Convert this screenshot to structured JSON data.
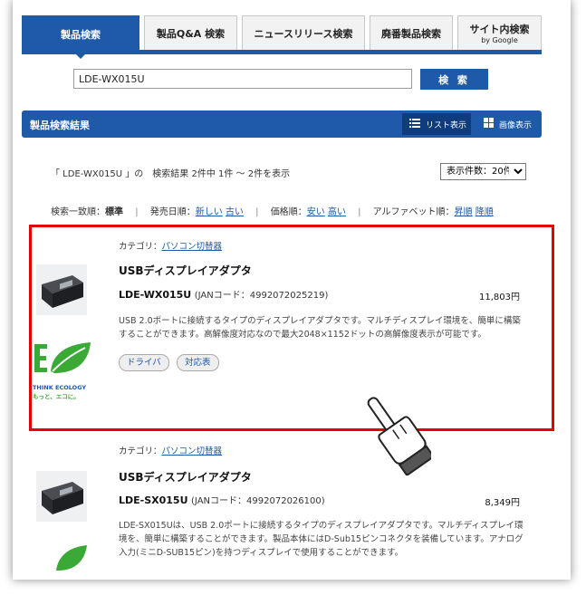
{
  "tabs": [
    {
      "label": "製品検索",
      "sub": ""
    },
    {
      "label": "製品Q&A 検索",
      "sub": ""
    },
    {
      "label": "ニュースリリース検索",
      "sub": ""
    },
    {
      "label": "廃番製品検索",
      "sub": ""
    },
    {
      "label": "サイト内検索",
      "sub": "by Google"
    }
  ],
  "search": {
    "value": "LDE-WX015U",
    "button": "検 索"
  },
  "results": {
    "title": "製品検索結果",
    "view_list": "リスト表示",
    "view_image": "画像表示",
    "summary": "「 LDE-WX015U 」の　検索結果 2件中 1件 ～ 2件を表示",
    "per_page": "表示件数：20件"
  },
  "sort": {
    "relevance_label": "検索一致順：",
    "relevance_value": "標準",
    "date_label": "発売日順：",
    "date_new": "新しい",
    "date_old": "古い",
    "price_label": "価格順：",
    "price_low": "安い",
    "price_high": "高い",
    "alpha_label": "アルファベット順：",
    "alpha_asc": "昇順",
    "alpha_desc": "降順"
  },
  "products": [
    {
      "category_label": "カテゴリ：",
      "category": "パソコン切替器",
      "name": "USBディスプレイアダプタ",
      "model": "LDE-WX015U",
      "jan": "(JANコード：4992072025219)",
      "price": "11,803円",
      "desc": "USB 2.0ポートに接続するタイプのディスプレイアダプタです。マルチディスプレイ環境を、簡単に構築することができます。高解像度対応なので最大2048×1152ドットの高解像度表示が可能です。",
      "chips": [
        "ドライバ",
        "対応表"
      ],
      "eco_label_1": "THINK ECOLOGY",
      "eco_label_2": "もっと、エコに。"
    },
    {
      "category_label": "カテゴリ：",
      "category": "パソコン切替器",
      "name": "USBディスプレイアダプタ",
      "model": "LDE-SX015U",
      "jan": "(JANコード：4992072026100)",
      "price": "8,349円",
      "desc": "LDE-SX015Uは、USB 2.0ポートに接続するタイプのディスプレイアダプタです。マルチディスプレイ環境を、簡単に構築することができます。製品本体にはD-Sub15ピンコネクタを装備しています。アナログ入力(ミニD-SUB15ピン)を持つディスプレイで使用することができます。"
    }
  ],
  "colors": {
    "brand": "#1e5aa8",
    "highlight": "#e60000",
    "eco_green": "#3aa935"
  }
}
